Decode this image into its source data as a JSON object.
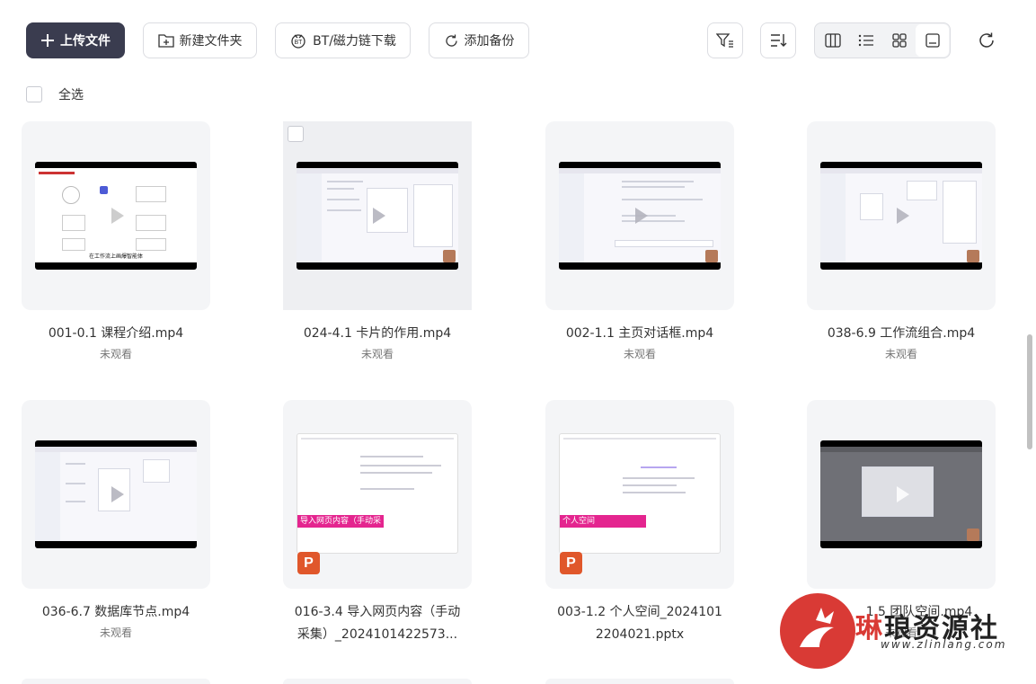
{
  "toolbar": {
    "upload_label": "上传文件",
    "new_folder_label": "新建文件夹",
    "bt_label": "BT/磁力链下载",
    "backup_label": "添加备份"
  },
  "select_all_label": "全选",
  "files": [
    {
      "name": "001-0.1 课程介绍.mp4",
      "status": "未观看",
      "caption": "在工作流上画爆智能体"
    },
    {
      "name": "024-4.1 卡片的作用.mp4",
      "status": "未观看",
      "caption": ""
    },
    {
      "name": "002-1.1 主页对话框.mp4",
      "status": "未观看",
      "caption": ""
    },
    {
      "name": "038-6.9 工作流组合.mp4",
      "status": "未观看",
      "caption": ""
    },
    {
      "name": "036-6.7 数据库节点.mp4",
      "status": "未观看",
      "caption": ""
    },
    {
      "name": "016-3.4 导入网页内容（手动采集）_2024101422573...",
      "status": "",
      "overlay": "导入网页内容（手动采集）"
    },
    {
      "name": "003-1.2 个人空间_2024101 2204021.pptx",
      "status": "",
      "overlay": "个人空间"
    },
    {
      "name": "1.5 团队空间.mp4",
      "status": "未观看",
      "caption": ""
    }
  ],
  "watermark": {
    "brand_first": "琳",
    "brand_rest": "琅资源社",
    "url": "www.zlinlang.com"
  },
  "colors": {
    "primary_button": "#3a3c4f",
    "ppt_badge": "#e0572b",
    "highlight": "#e4258f",
    "watermark": "#d93a35"
  },
  "icons": [
    "plus-icon",
    "folder-plus-icon",
    "bt-icon",
    "sync-icon",
    "filter-icon",
    "sort-icon",
    "columns-view-icon",
    "list-view-icon",
    "grid-view-icon",
    "card-view-icon",
    "refresh-icon",
    "play-icon",
    "ppt-icon"
  ]
}
